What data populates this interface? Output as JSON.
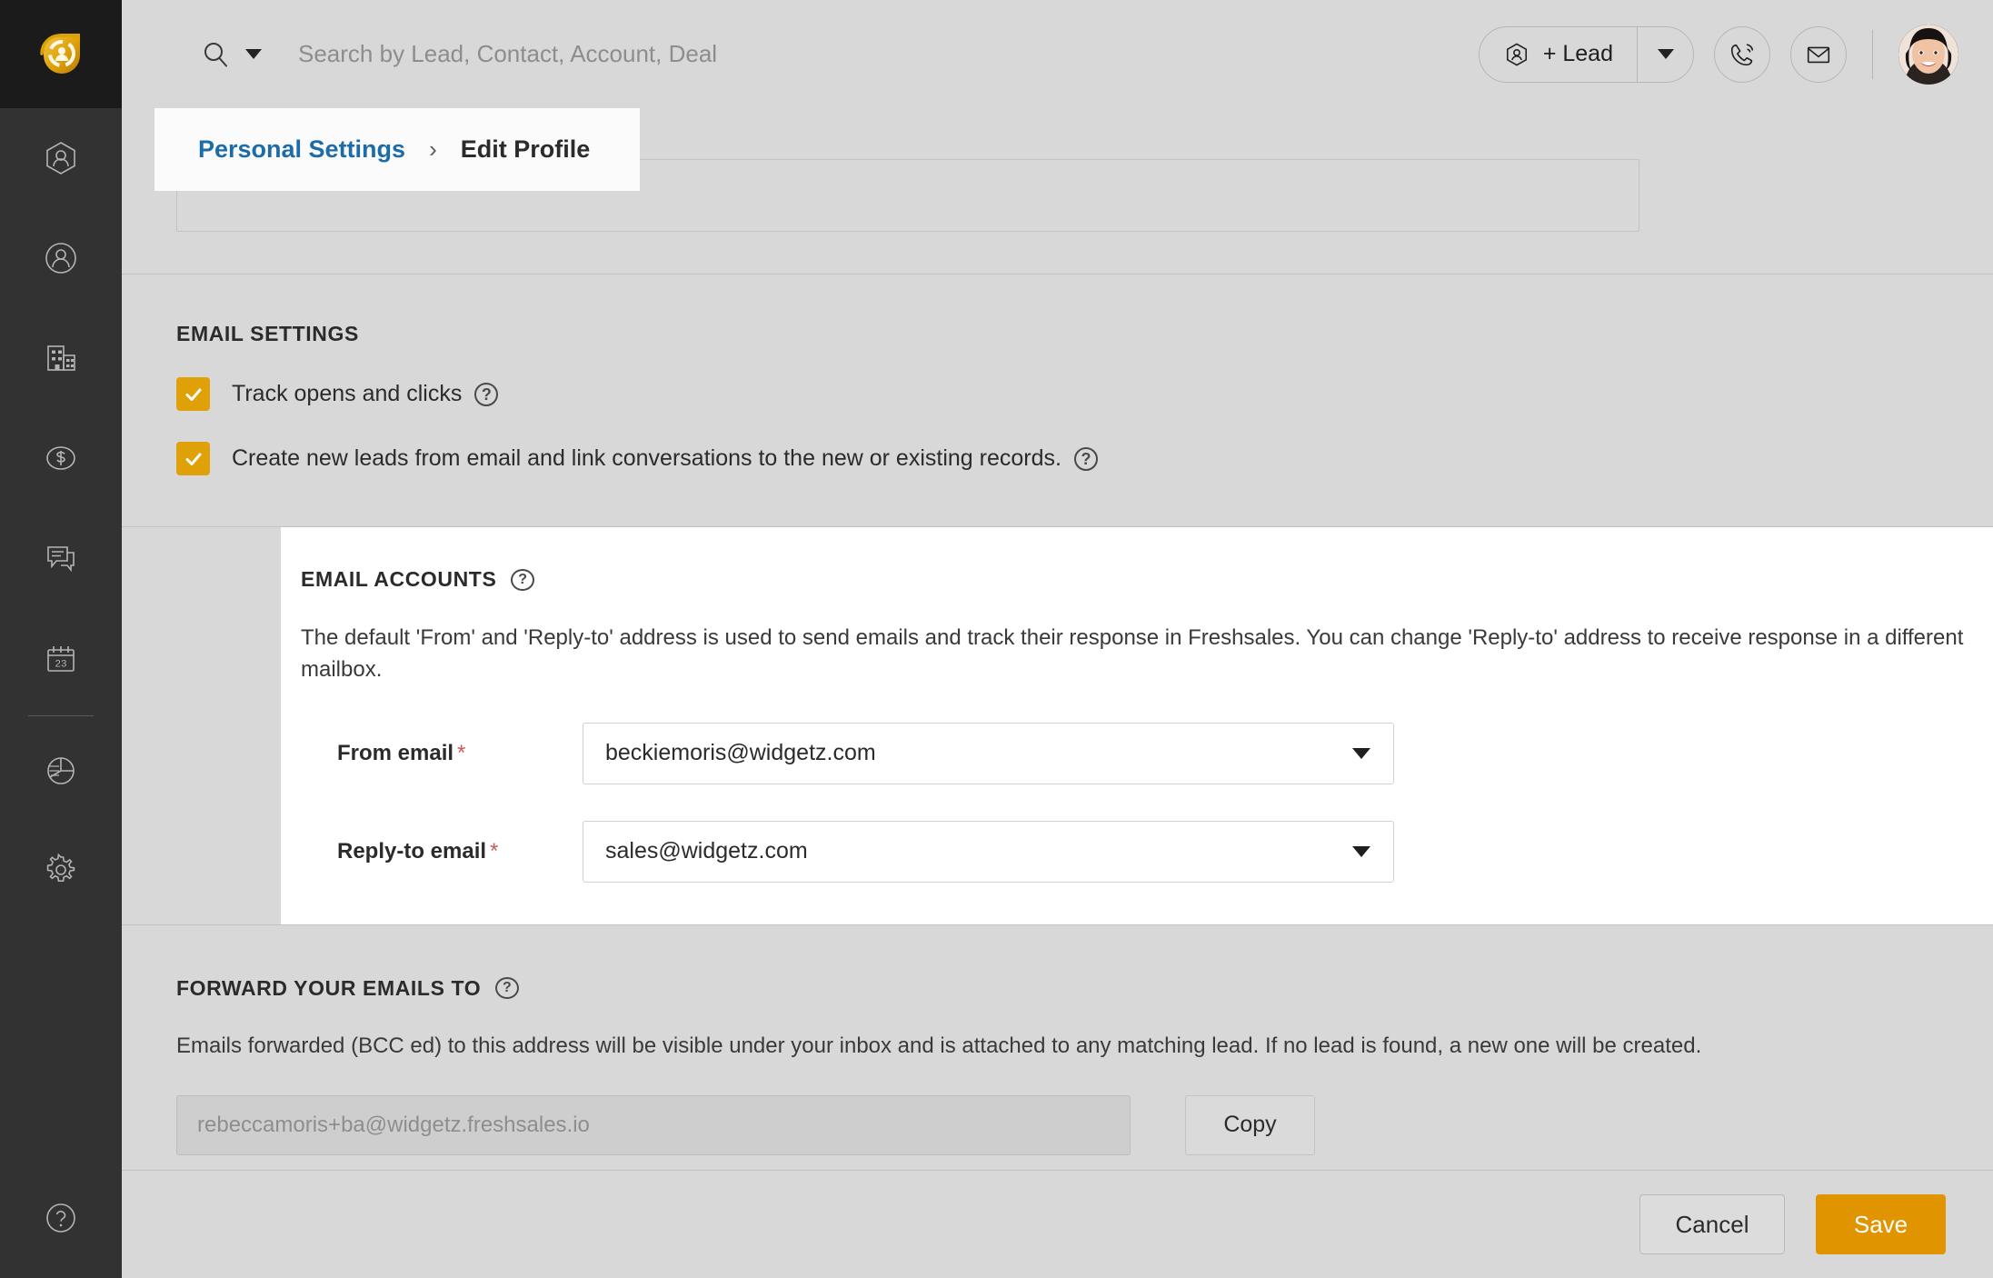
{
  "app": {
    "logo_icon": "freshsales-logo-icon",
    "accent_orange": "#e0a007",
    "save_orange": "#e09400",
    "link_blue": "#1b6ca8",
    "rail_bg": "#323232",
    "page_bg": "#d8d8d8"
  },
  "sidebar": {
    "items": [
      {
        "icon": "lead-hexagon-person-icon",
        "label": "Leads"
      },
      {
        "icon": "contact-circle-person-icon",
        "label": "Contacts"
      },
      {
        "icon": "account-building-icon",
        "label": "Accounts"
      },
      {
        "icon": "deal-dollar-circle-icon",
        "label": "Deals"
      },
      {
        "icon": "conversations-chat-bubbles-icon",
        "label": "Conversations"
      },
      {
        "icon": "calendar-23-icon",
        "label": "Calendar"
      }
    ],
    "items_after_divider": [
      {
        "icon": "reports-pie-chart-icon",
        "label": "Reports"
      },
      {
        "icon": "settings-gear-icon",
        "label": "Settings"
      }
    ],
    "help": {
      "icon": "help-question-circle-icon",
      "label": "Help"
    }
  },
  "topbar": {
    "search_icon": "search-magnifier-icon",
    "search_dropdown_icon": "chevron-down-icon",
    "search": {
      "value": "",
      "placeholder": "Search by Lead, Contact, Account, Deal"
    },
    "add_lead": {
      "label": "+ Lead",
      "icon": "lead-hexagon-person-icon"
    },
    "add_lead_caret_icon": "chevron-down-icon",
    "phone_icon": "phone-call-icon",
    "mail_icon": "envelope-icon",
    "avatar": "user-avatar"
  },
  "breadcrumb": {
    "root": "Personal Settings",
    "separator": "›",
    "current": "Edit Profile"
  },
  "email_settings": {
    "title": "EMAIL SETTINGS",
    "checkboxes": [
      {
        "label": "Track opens and clicks",
        "checked": true,
        "help_icon": "help-question-circle-icon"
      },
      {
        "label": "Create new leads from email and link conversations to the new or existing records.",
        "checked": true,
        "help_icon": "help-question-circle-icon"
      }
    ]
  },
  "email_accounts": {
    "title": "EMAIL ACCOUNTS",
    "help_icon": "help-question-circle-icon",
    "description": "The default 'From' and 'Reply-to' address is used to send emails and track their response in Freshsales. You can change 'Reply-to' address to receive response in a different mailbox.",
    "fields": [
      {
        "label": "From email",
        "required": true,
        "value": "beckiemoris@widgetz.com",
        "caret_icon": "chevron-down-icon"
      },
      {
        "label": "Reply-to email",
        "required": true,
        "value": "sales@widgetz.com",
        "caret_icon": "chevron-down-icon"
      }
    ]
  },
  "forward_emails": {
    "title": "FORWARD YOUR EMAILS TO",
    "help_icon": "help-question-circle-icon",
    "description": "Emails forwarded (BCC ed) to this address will be visible under your inbox and is attached to any matching lead. If no lead is found, a new one will be created.",
    "address": {
      "value": "",
      "placeholder": "rebeccamoris+ba@widgetz.freshsales.io"
    },
    "copy_label": "Copy"
  },
  "footer": {
    "cancel_label": "Cancel",
    "save_label": "Save"
  }
}
